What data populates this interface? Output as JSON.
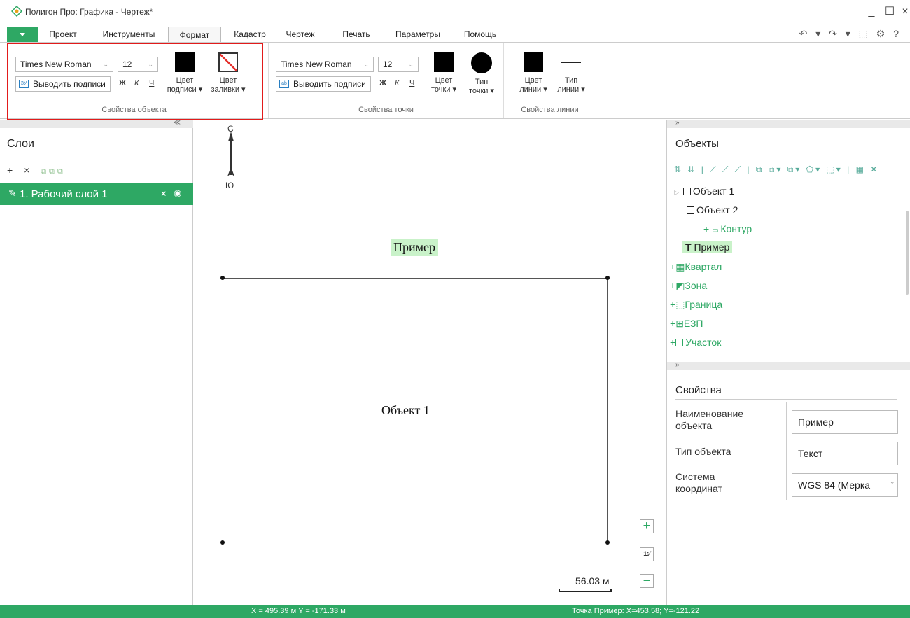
{
  "window": {
    "title": "Полигон Про: Графика - Чертеж*",
    "controls": [
      "_",
      "☐",
      "×"
    ]
  },
  "menu": {
    "items": [
      "Проект",
      "Инструменты",
      "Формат",
      "Кадастр",
      "Чертеж",
      "Печать",
      "Параметры",
      "Помощь"
    ],
    "active": "Формат",
    "quick_access": "↶ ▾ ↷ ▾ ⬚ ⚙ ?"
  },
  "ribbon": {
    "object_group": {
      "font": "Times New Roman",
      "size": "12",
      "labels_btn": "Выводить подписи",
      "bold": "Ж",
      "italic": "К",
      "underline": "Ч",
      "label_color": "Цвет\nподписи ▾",
      "fill_color": "Цвет\nзаливки ▾",
      "group_label": "Свойства объекта"
    },
    "point_group": {
      "font": "Times New Roman",
      "size": "12",
      "labels_btn": "Выводить подписи",
      "bold": "Ж",
      "italic": "К",
      "underline": "Ч",
      "point_color": "Цвет\nточки ▾",
      "point_type": "Тип\nточки ▾",
      "group_label": "Свойства точки"
    },
    "line_group": {
      "line_color": "Цвет\nлинии ▾",
      "line_type": "Тип\nлинии ▾",
      "group_label": "Свойства линии"
    }
  },
  "layers": {
    "collapse": "≪",
    "title": "Слои",
    "toolbar_main": "+ ×",
    "items": [
      {
        "label": "1. Рабочий слой 1",
        "active": true
      }
    ]
  },
  "canvas": {
    "north": "С",
    "south": "Ю",
    "example_text": "Пример",
    "object_text": "Объект 1",
    "scale": "56.03 м"
  },
  "objects_panel": {
    "collapse": "»",
    "title": "Объекты",
    "tree": [
      {
        "label": "Объект 1"
      },
      {
        "label": "Объект 2"
      },
      {
        "label": "Контур"
      },
      {
        "label": "Пример"
      },
      {
        "label": "Квартал"
      },
      {
        "label": "Зона"
      },
      {
        "label": "Граница"
      },
      {
        "label": "ЕЗП"
      },
      {
        "label": "Участок"
      }
    ]
  },
  "properties_panel": {
    "collapse": "»",
    "title": "Свойства",
    "rows": [
      {
        "label": "Наименование объекта",
        "value": "Пример"
      },
      {
        "label": "Тип объекта",
        "value": "Текст"
      },
      {
        "label": "Система координат",
        "value": "WGS 84 (Мерка"
      }
    ]
  },
  "status": {
    "coords": "X = 495.39 м   Y = -171.33 м",
    "point": "Точка Пример: X=453.58; Y=-121.22"
  },
  "colors": {
    "accent": "#2ea864",
    "highlight_border": "#e21b1b",
    "selection": "#c9f2c9"
  }
}
